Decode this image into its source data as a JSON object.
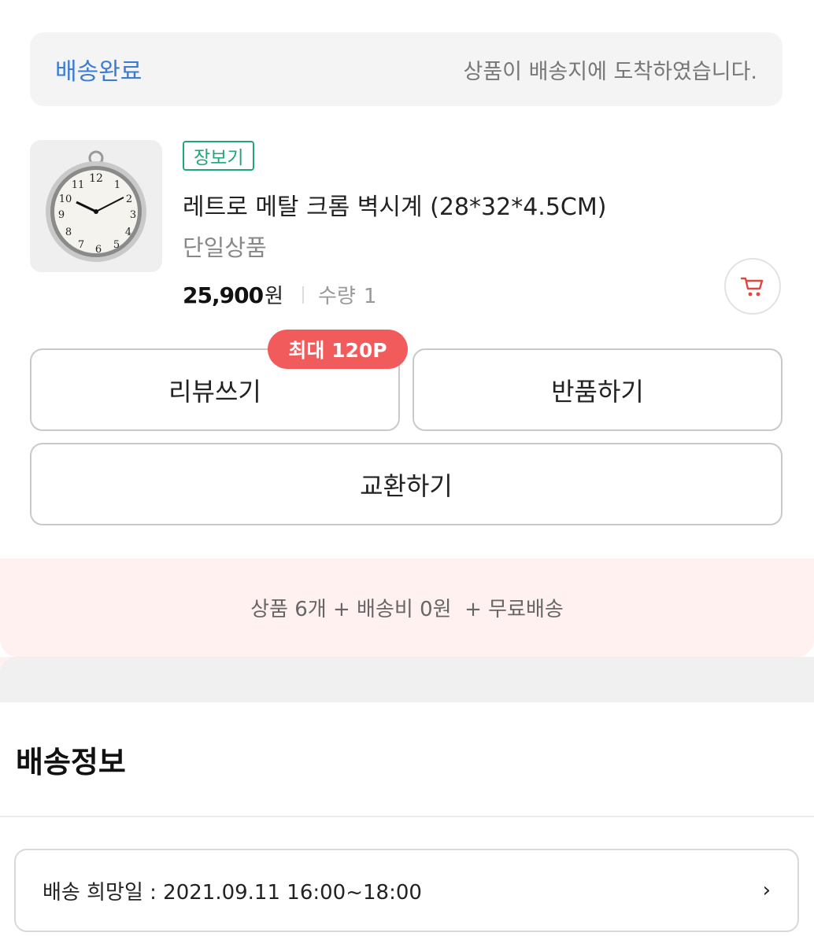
{
  "status": {
    "label": "배송완료",
    "message": "상품이 배송지에 도착하였습니다."
  },
  "product": {
    "tag": "장보기",
    "name": "레트로 메탈 크롬 벽시계 (28*32*4.5CM)",
    "option": "단일상품",
    "price": "25,900",
    "currency": "원",
    "quantity_label": "수량",
    "quantity": "1",
    "icons": {
      "thumbnail": "wall-clock-image",
      "cart": "cart-icon"
    }
  },
  "actions": {
    "review": "리뷰쓰기",
    "review_badge": "최대 120P",
    "return": "반품하기",
    "exchange": "교환하기"
  },
  "summary": "상품 6개 + 배송비 0원  + 무료배송",
  "delivery": {
    "title": "배송정보",
    "wish_date": "배송 희망일 : 2021.09.11 16:00~18:00",
    "chevron": "›"
  },
  "colors": {
    "accent_blue": "#3a7bd5",
    "tag_green": "#1ea67a",
    "badge_red": "#f15b5b",
    "summary_bg": "#fff1ef"
  }
}
